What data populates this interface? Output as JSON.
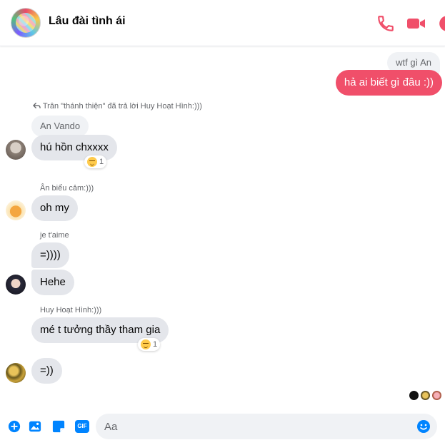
{
  "header": {
    "title": "Lâu đài tình ái",
    "accent_color": "#f04f6a",
    "icons": [
      "phone-icon",
      "video-icon",
      "info-icon"
    ]
  },
  "messages": {
    "mine_quote": "wtf gì An",
    "mine_text": "hả ai biết gì đâu :))",
    "reply_note": "Trân \"thánh thiện\" đã trả lời Huy Hoạt Hình:)))",
    "quote_an_vando": "An Vando",
    "msg1_text": "hú hồn chxxxx",
    "msg1_reaction_count": "1",
    "sender2": "Ân biểu cảm:)))",
    "msg2_text": "oh my",
    "sender3": "je t'aime",
    "msg3a_text": "=))))",
    "msg3b_text": "Hehe",
    "sender4": "Huy Hoạt Hình:)))",
    "msg4_text": "mé t tưởng thầy tham gia",
    "msg4_reaction_count": "1",
    "msg5_text": "=))"
  },
  "composer": {
    "placeholder": "Aa",
    "icons": [
      "plus-icon",
      "image-icon",
      "sticker-icon",
      "gif-icon",
      "emoji-icon"
    ],
    "gif_label": "GIF"
  }
}
